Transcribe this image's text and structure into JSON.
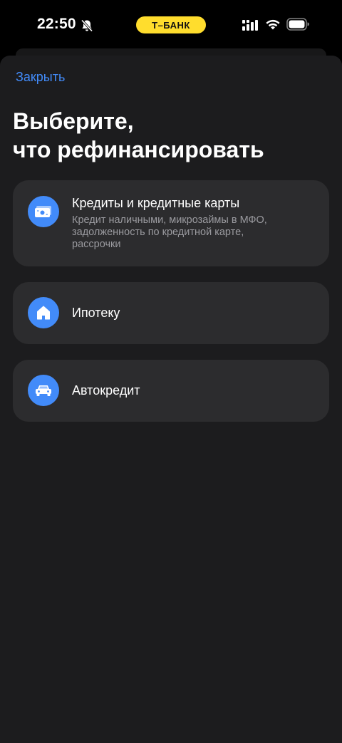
{
  "status_bar": {
    "time": "22:50",
    "bank_label": "Т–БАНК",
    "icons": [
      "bell-off-icon",
      "signal-icon",
      "wifi-icon",
      "battery-icon"
    ]
  },
  "header": {
    "close_label": "Закрыть",
    "title_line1": "Выберите,",
    "title_line2": "что рефинансировать"
  },
  "options": [
    {
      "title": "Кредиты и кредитные карты",
      "description": "Кредит наличными, микрозаймы в МФО, задолженность по кредитной карте, рассрочки",
      "icon": "banknote-icon"
    },
    {
      "title": "Ипотеку",
      "icon": "house-icon"
    },
    {
      "title": "Автокредит",
      "icon": "car-icon"
    }
  ],
  "colors": {
    "accent": "#428bf9",
    "card_bg": "#2c2c2e",
    "sheet_bg": "#1c1c1e",
    "brand_yellow": "#ffdd2d"
  }
}
